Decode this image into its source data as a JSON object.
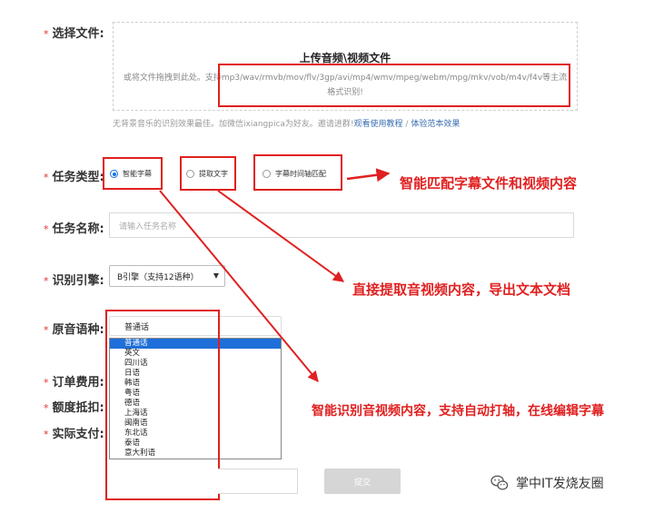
{
  "form": {
    "file_label": "选择文件:",
    "upload_title": "上传音频\\视频文件",
    "upload_desc": "或将文件拖拽到此处。支持mp3/wav/rmvb/mov/flv/3gp/avi/mp4/wmv/mpeg/webm/mpg/mkv/vob/m4v/f4v等主流格式识别!",
    "hint_prefix": "无背景音乐的识别效果最佳。加微信ixiangpica为好友。邀请进群!",
    "hint_link1": "观看使用教程",
    "hint_sep": " / ",
    "hint_link2": "体验范本效果",
    "task_type_label": "任务类型:",
    "task_types": [
      "智能字幕",
      "提取文字",
      "字幕时间轴匹配"
    ],
    "task_type_selected": "智能字幕",
    "task_name_label": "任务名称:",
    "task_name_placeholder": "请输入任务名称",
    "engine_label": "识别引擎:",
    "engine_value": "B引擎（支持12语种）",
    "language_label": "原音语种:",
    "language_value": "普通话",
    "language_options": [
      "普通话",
      "英文",
      "四川话",
      "日语",
      "韩语",
      "粤语",
      "德语",
      "上海话",
      "闽南语",
      "东北话",
      "泰语",
      "意大利语"
    ],
    "order_fee_label": "订单费用:",
    "quota_label": "额度抵扣:",
    "pay_label": "实际支付:",
    "submit_label": "提交"
  },
  "annotations": {
    "smart_subtitle": "智能匹配字幕文件和视频内容",
    "extract_text": "直接提取音视频内容，导出文本文档",
    "smart_recognize": "智能识别音视频内容，支持自动打轴，在线编辑字幕",
    "accent_color": "#e02020"
  },
  "watermark": {
    "text": "掌中IT发烧友圈",
    "icon": "wechat-icon"
  }
}
